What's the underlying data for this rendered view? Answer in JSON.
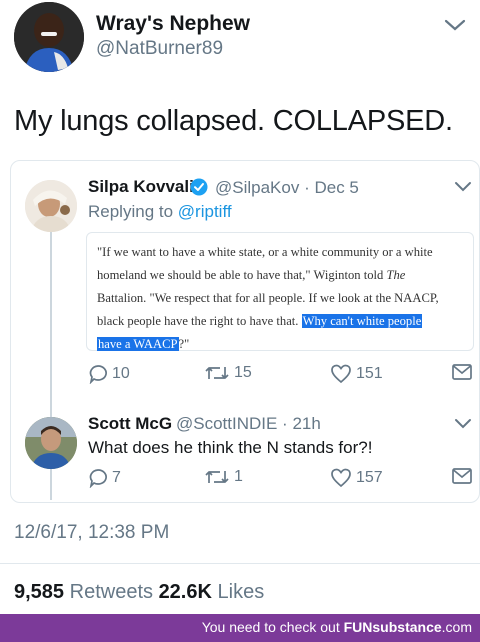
{
  "tweet": {
    "author_name": "Wray's Nephew",
    "author_handle": "@NatBurner89",
    "text": "My lungs collapsed. COLLAPSED.",
    "timestamp": "12/6/17, 12:38 PM",
    "retweets_count": "9,585",
    "retweets_label": "Retweets",
    "likes_count": "22.6K",
    "likes_label": "Likes"
  },
  "quoted_tweet": {
    "author_name": "Silpa Kovvali",
    "author_handle": "@SilpaKov",
    "date": "· Dec 5",
    "replying_prefix": "Replying to",
    "replying_to": "@riptiff",
    "image_lines": [
      "\"If we want to have a white state, or a white community or a white",
      "homeland we should be able to have that,\" Wiginton told ",
      "Battalion. \"We respect that for all people. If we look at the NAACP,",
      "black people have the right to have that. ",
      "have a WAACP",
      "?\""
    ],
    "image_italic": "The",
    "image_highlight_1": "Why can't white people",
    "replies": "10",
    "retweets": "15",
    "likes": "151"
  },
  "reply_tweet": {
    "author_name": "Scott McG",
    "author_handle": "@ScottINDIE · 21h",
    "text": "What does he think the N stands for?!",
    "replies": "7",
    "retweets": "1",
    "likes": "157"
  },
  "footer": {
    "prefix": "You need to check out ",
    "brand": "FUNsubstance",
    "suffix": ".com"
  },
  "colors": {
    "link": "#1b95e0",
    "gray_text": "#657786",
    "highlight": "#1a73e8",
    "footer_bg": "#7c3a99"
  }
}
